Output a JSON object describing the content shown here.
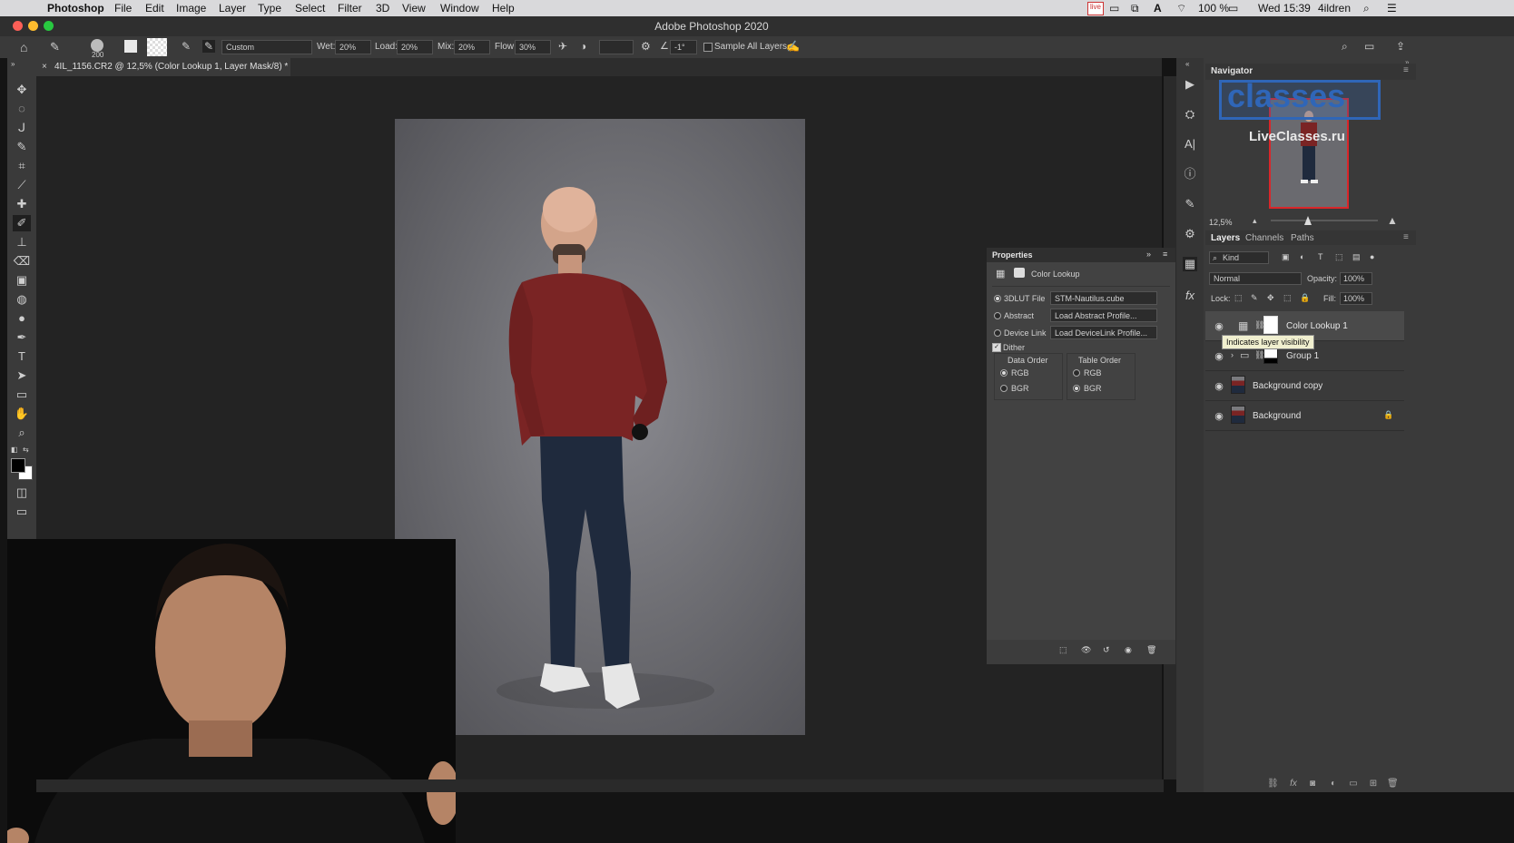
{
  "menubar": {
    "app_name": "Photoshop",
    "items": [
      "File",
      "Edit",
      "Image",
      "Layer",
      "Type",
      "Select",
      "Filter",
      "3D",
      "View",
      "Window",
      "Help"
    ],
    "status": {
      "battery": "100 %",
      "datetime": "Wed 15:39",
      "user": "4ildren"
    }
  },
  "window": {
    "title": "Adobe Photoshop 2020"
  },
  "options_bar": {
    "brush_size": "200",
    "preset": "Custom",
    "wet_label": "Wet:",
    "wet_value": "20%",
    "load_label": "Load:",
    "load_value": "20%",
    "mix_label": "Mix:",
    "mix_value": "20%",
    "flow_label": "Flow:",
    "flow_value": "30%",
    "angle_value": "-1°",
    "sample_all_layers": "Sample All Layers"
  },
  "document_tab": {
    "label": "4IL_1156.CR2 @ 12,5% (Color Lookup 1, Layer Mask/8) *"
  },
  "tools": [
    "move-icon",
    "marquee-icon",
    "lasso-icon",
    "quick-select-icon",
    "crop-icon",
    "eyedropper-icon",
    "healing-icon",
    "brush-icon",
    "stamp-icon",
    "eraser-icon",
    "gradient-icon",
    "blur-icon",
    "dodge-icon",
    "pen-icon",
    "type-icon",
    "path-select-icon",
    "shape-icon",
    "hand-icon",
    "zoom-icon"
  ],
  "tool_glyphs": [
    "✥",
    "◌",
    "ᒍ",
    "✎",
    "⌗",
    "⟋",
    "✚",
    "✐",
    "⊥",
    "⌫",
    "▣",
    "◍",
    "●",
    "✒",
    "T",
    "➤",
    "▭",
    "✋",
    "⌕"
  ],
  "dock_icons": [
    "play-icon",
    "stamp-source-icon",
    "character-icon",
    "info-icon",
    "brush-settings-icon",
    "adjust-icon",
    "properties-icon",
    "fx-icon"
  ],
  "dock_glyphs": [
    "▶",
    "⛭",
    "A|",
    "ⓘ",
    "✎",
    "⚙",
    "▦",
    "fx"
  ],
  "properties": {
    "title": "Properties",
    "subtitle": "Color Lookup",
    "lut_label": "3DLUT File",
    "lut_value": "STM-Nautilus.cube",
    "abstract_label": "Abstract",
    "abstract_value": "Load Abstract Profile...",
    "devlink_label": "Device Link",
    "devlink_value": "Load DeviceLink Profile...",
    "dither_label": "Dither",
    "data_order": {
      "title": "Data Order",
      "options": [
        "RGB",
        "BGR"
      ],
      "selected": "RGB"
    },
    "table_order": {
      "title": "Table Order",
      "options": [
        "RGB",
        "BGR"
      ],
      "selected": "BGR"
    }
  },
  "navigator": {
    "title": "Navigator",
    "zoom": "12,5%",
    "watermark_big": "classes",
    "watermark_small": "LiveClasses.ru"
  },
  "layers_panel": {
    "tabs": [
      "Layers",
      "Channels",
      "Paths"
    ],
    "filter": "Kind",
    "blend_mode": "Normal",
    "opacity_label": "Opacity:",
    "opacity_value": "100%",
    "lock_label": "Lock:",
    "fill_label": "Fill:",
    "fill_value": "100%",
    "layers": [
      "Color Lookup 1",
      "Group 1",
      "Background copy",
      "Background"
    ],
    "tooltip": "Indicates layer visibility"
  },
  "colors": {
    "accent_red": "#d9262a",
    "watermark_blue": "#2f66b8",
    "shirt": "#7a2424",
    "jeans": "#1f2a3d"
  }
}
